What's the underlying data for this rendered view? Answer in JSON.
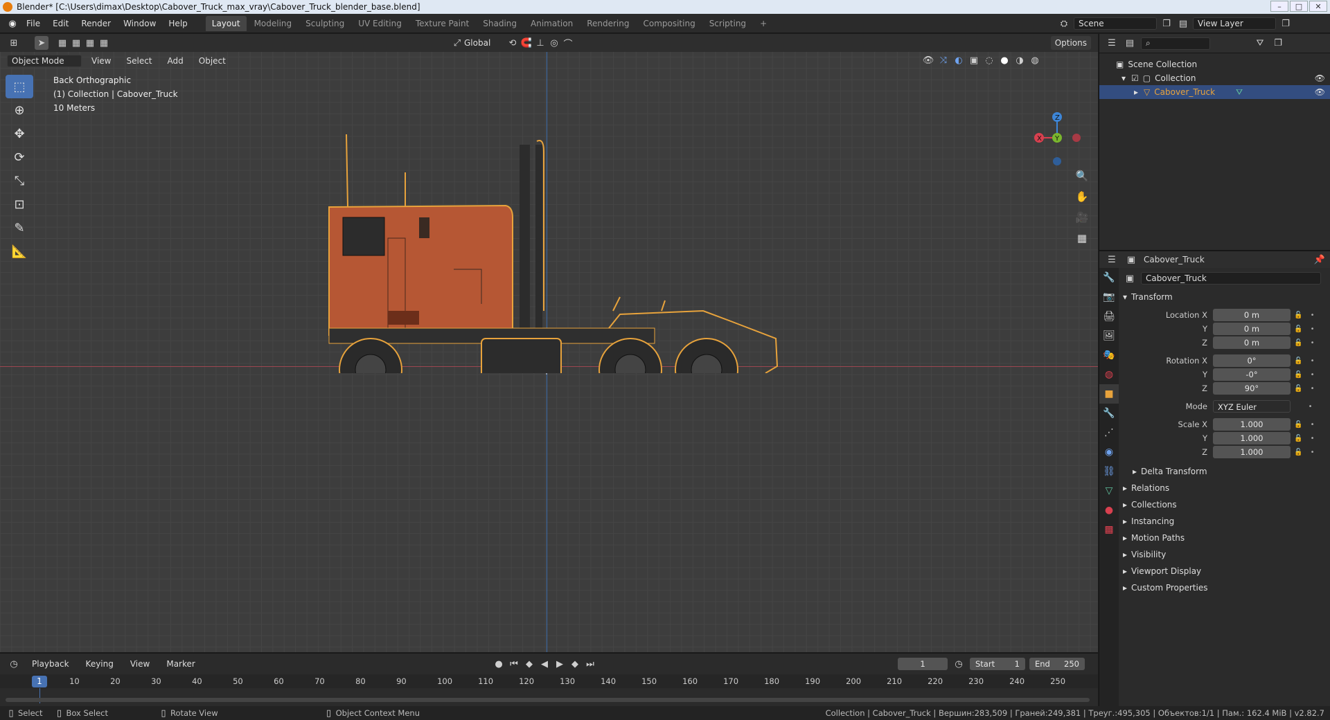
{
  "window": {
    "title": "Blender* [C:\\Users\\dimax\\Desktop\\Cabover_Truck_max_vray\\Cabover_Truck_blender_base.blend]"
  },
  "menu": [
    "File",
    "Edit",
    "Render",
    "Window",
    "Help"
  ],
  "workspaces": [
    {
      "label": "Layout",
      "active": true
    },
    {
      "label": "Modeling"
    },
    {
      "label": "Sculpting"
    },
    {
      "label": "UV Editing"
    },
    {
      "label": "Texture Paint"
    },
    {
      "label": "Shading"
    },
    {
      "label": "Animation"
    },
    {
      "label": "Rendering"
    },
    {
      "label": "Compositing"
    },
    {
      "label": "Scripting"
    }
  ],
  "add_workspace": "+",
  "scene": {
    "label": "Scene"
  },
  "view_layer": {
    "label": "View Layer"
  },
  "viewport_header": {
    "transform_orientation": "Global",
    "options": "Options",
    "mode": "Object Mode",
    "menus": [
      "View",
      "Select",
      "Add",
      "Object"
    ]
  },
  "viewport_info": {
    "view": "Back Orthographic",
    "collection": "(1) Collection | Cabover_Truck",
    "scale": "10 Meters"
  },
  "gizmo": {
    "x": "X",
    "y": "Y",
    "z": "Z"
  },
  "outliner": {
    "scene_collection": "Scene Collection",
    "collection": "Collection",
    "object": "Cabover_Truck"
  },
  "properties": {
    "header_object": "Cabover_Truck",
    "object_name": "Cabover_Truck",
    "transform_label": "Transform",
    "location": [
      {
        "label": "Location X",
        "value": "0 m"
      },
      {
        "label": "Y",
        "value": "0 m"
      },
      {
        "label": "Z",
        "value": "0 m"
      }
    ],
    "rotation": [
      {
        "label": "Rotation X",
        "value": "0°"
      },
      {
        "label": "Y",
        "value": "-0°"
      },
      {
        "label": "Z",
        "value": "90°"
      }
    ],
    "mode": {
      "label": "Mode",
      "value": "XYZ Euler"
    },
    "scale": [
      {
        "label": "Scale X",
        "value": "1.000"
      },
      {
        "label": "Y",
        "value": "1.000"
      },
      {
        "label": "Z",
        "value": "1.000"
      }
    ],
    "delta": "Delta Transform",
    "sections": [
      "Relations",
      "Collections",
      "Instancing",
      "Motion Paths",
      "Visibility",
      "Viewport Display",
      "Custom Properties"
    ]
  },
  "timeline": {
    "menus": [
      "Playback",
      "Keying",
      "View",
      "Marker"
    ],
    "current_frame": "1",
    "start_label": "Start",
    "start": "1",
    "end_label": "End",
    "end": "250",
    "ticks": [
      "1",
      "10",
      "20",
      "30",
      "40",
      "50",
      "60",
      "70",
      "80",
      "90",
      "100",
      "110",
      "120",
      "130",
      "140",
      "150",
      "160",
      "170",
      "180",
      "190",
      "200",
      "210",
      "220",
      "230",
      "240",
      "250"
    ]
  },
  "statusbar": {
    "select": "Select",
    "box_select": "Box Select",
    "rotate_view": "Rotate View",
    "context_menu": "Object Context Menu",
    "stats": "Collection | Cabover_Truck | Вершин:283,509 | Граней:249,381 | Треуг.:495,305 | Объектов:1/1 | Пам.: 162.4 МiB | v2.82.7"
  },
  "colors": {
    "accent": "#4772b3",
    "selection": "#e8a33c",
    "truck_body": "#b65734",
    "x_axis": "#d8404f",
    "y_axis": "#7ab62e",
    "z_axis": "#3d86d8"
  }
}
